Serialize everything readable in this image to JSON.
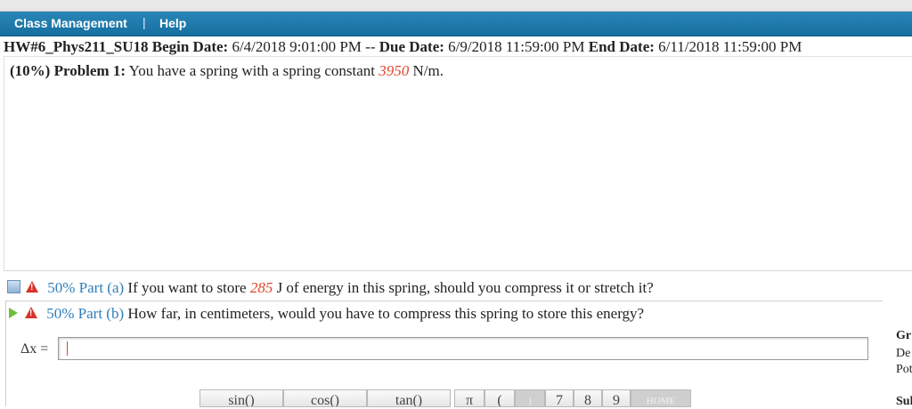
{
  "menu": {
    "class_management": "Class Management",
    "separator": "|",
    "help": "Help"
  },
  "assignment": {
    "name": "HW#6_Phys211_SU18",
    "begin_label": "Begin Date:",
    "begin_value": "6/4/2018 9:01:00 PM",
    "dash": "--",
    "due_label": "Due Date:",
    "due_value": "6/9/2018 11:59:00 PM",
    "end_label": "End Date:",
    "end_value": "6/11/2018 11:59:00 PM"
  },
  "problem": {
    "percent": "(10%)",
    "label": "Problem 1:",
    "text_before": "You have a spring with a spring constant",
    "constant": "3950",
    "unit": "N/m."
  },
  "parts": [
    {
      "percent": "50% Part (a)",
      "text_before": "If you want to store",
      "value": "285",
      "text_after": "J of energy in this spring, should you compress it or stretch it?"
    },
    {
      "percent": "50% Part (b)",
      "text": "How far, in centimeters, would you have to compress this spring to store this energy?"
    }
  ],
  "answer": {
    "label": "Δx =",
    "value": ""
  },
  "right_panel": {
    "line1": "Gr",
    "line2": "De",
    "line3": "Pot",
    "line4": "Sul"
  },
  "keypad": [
    "sin()",
    "cos()",
    "tan()",
    "π",
    "(",
    ")",
    "7",
    "8",
    "9",
    "HOME"
  ],
  "colors": {
    "menu_bar": "#1e7aac",
    "highlight_value": "#e0452b",
    "part_label": "#2f7fba"
  }
}
